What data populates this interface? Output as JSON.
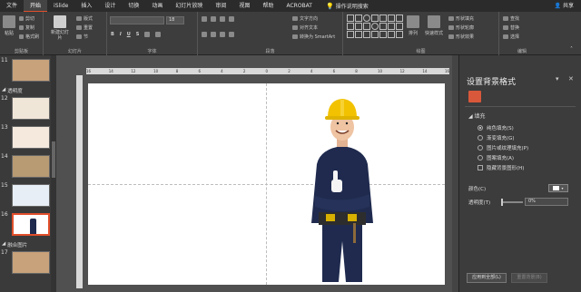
{
  "menu": {
    "tabs": [
      "文件",
      "开始",
      "iSlide",
      "插入",
      "设计",
      "切换",
      "动画",
      "幻灯片放映",
      "审阅",
      "视图",
      "帮助",
      "ACROBAT"
    ],
    "active_index": 1,
    "search_label": "操作说明搜索",
    "share_label": "共享"
  },
  "ribbon": {
    "clipboard": {
      "paste": "粘贴",
      "cut": "剪切",
      "copy": "复制",
      "format_painter": "格式刷",
      "label": "剪贴板"
    },
    "slides": {
      "new_slide": "新建幻灯片",
      "layout": "版式",
      "reset": "重置",
      "section": "节",
      "label": "幻灯片"
    },
    "font": {
      "font_size": "18",
      "bold": "B",
      "italic": "I",
      "underline": "U",
      "strike": "S",
      "label": "字体"
    },
    "paragraph": {
      "text_direction": "文字方向",
      "align_text": "对齐文本",
      "smartart": "转换为 SmartArt",
      "label": "段落"
    },
    "drawing": {
      "arrange": "排列",
      "quick_styles": "快速样式",
      "shape_fill": "形状填充",
      "shape_outline": "形状轮廓",
      "shape_effects": "形状效果",
      "label": "绘图"
    },
    "editing": {
      "find": "查找",
      "replace": "替换",
      "select": "选择",
      "label": "编辑"
    }
  },
  "slides_panel": {
    "items": [
      {
        "num": "11"
      },
      {
        "section": "透明度"
      },
      {
        "num": "12"
      },
      {
        "num": "13"
      },
      {
        "num": "14"
      },
      {
        "num": "15"
      },
      {
        "num": "16",
        "selected": true
      },
      {
        "section": "融合图片"
      },
      {
        "num": "17"
      }
    ]
  },
  "ruler": {
    "labels": [
      "16",
      "14",
      "12",
      "10",
      "8",
      "6",
      "4",
      "2",
      "0",
      "2",
      "4",
      "6",
      "8",
      "10",
      "12",
      "14",
      "16"
    ]
  },
  "format_pane": {
    "title": "设置背景格式",
    "section": "填充",
    "options": [
      {
        "label": "纯色填充(S)",
        "type": "radio",
        "selected": true
      },
      {
        "label": "渐变填充(G)",
        "type": "radio",
        "selected": false
      },
      {
        "label": "图片或纹理填充(P)",
        "type": "radio",
        "selected": false
      },
      {
        "label": "图案填充(A)",
        "type": "radio",
        "selected": false
      },
      {
        "label": "隐藏背景图形(H)",
        "type": "checkbox",
        "selected": false
      }
    ],
    "color_label": "颜色(C)",
    "transparency_label": "透明度(T)",
    "transparency_value": "0%",
    "apply_all": "应用到全部(L)",
    "reset_bg": "重置背景(B)"
  },
  "colors": {
    "accent": "#e14f2b",
    "helmet": "#f2c200",
    "uniform": "#1f2a4e"
  }
}
